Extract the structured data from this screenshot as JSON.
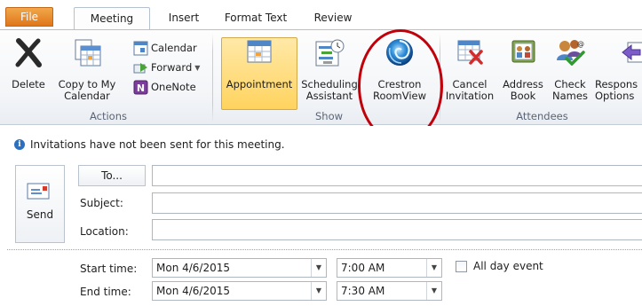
{
  "tabs": {
    "file": "File",
    "meeting": "Meeting",
    "insert": "Insert",
    "format_text": "Format Text",
    "review": "Review"
  },
  "ribbon": {
    "actions": {
      "label": "Actions",
      "delete": "Delete",
      "copy_line1": "Copy to My",
      "copy_line2": "Calendar",
      "calendar": "Calendar",
      "forward": "Forward",
      "onenote": "OneNote"
    },
    "show": {
      "label": "Show",
      "appointment": "Appointment",
      "scheduling_line1": "Scheduling",
      "scheduling_line2": "Assistant",
      "crestron_line1": "Crestron",
      "crestron_line2": "RoomView"
    },
    "attendees": {
      "label": "Attendees",
      "cancel_line1": "Cancel",
      "cancel_line2": "Invitation",
      "address_line1": "Address",
      "address_line2": "Book",
      "check_line1": "Check",
      "check_line2": "Names",
      "response_line1": "Respons",
      "response_line2": "Options"
    }
  },
  "form": {
    "info": "Invitations have not been sent for this meeting.",
    "send": "Send",
    "to": "To...",
    "subject_label": "Subject:",
    "location_label": "Location:",
    "to_value": "",
    "subject_value": "",
    "location_value": "",
    "start_label": "Start time:",
    "end_label": "End time:",
    "start_date": "Mon 4/6/2015",
    "start_time": "7:00 AM",
    "end_date": "Mon 4/6/2015",
    "end_time": "7:30 AM",
    "all_day": "All day event"
  },
  "colors": {
    "file_tab": "#e0761a",
    "appointment_highlight": "#ffd35e",
    "annotation_circle": "#c0000a"
  }
}
